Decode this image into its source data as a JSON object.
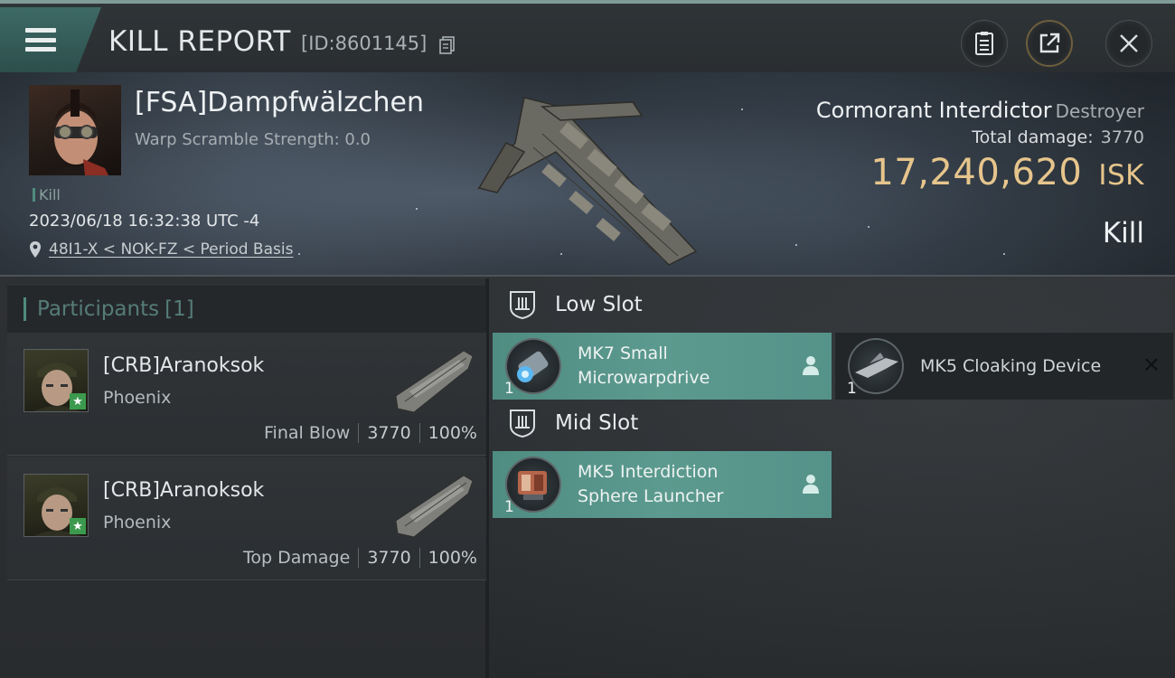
{
  "header": {
    "title": "KILL REPORT",
    "report_id": "[ID:8601145]",
    "icons": [
      "menu-icon",
      "copy-icon",
      "clipboard-icon",
      "share-icon",
      "close-icon"
    ]
  },
  "victim": {
    "name": "[FSA]Dampfwälzchen",
    "warp_scramble": "Warp Scramble Strength: 0.0",
    "tag": "Kill",
    "datetime": "2023/06/18 16:32:38 UTC -4",
    "location": "48I1-X < NOK-FZ < Period Basis"
  },
  "ship": {
    "name": "Cormorant Interdictor",
    "class": "Destroyer",
    "total_damage_label": "Total damage:",
    "total_damage_value": "3770",
    "value": "17,240,620",
    "currency": "ISK",
    "result": "Kill"
  },
  "participants": {
    "title": "Participants",
    "count": "[1]",
    "rows": [
      {
        "name": "[CRB]Aranoksok",
        "ship": "Phoenix",
        "role": "Final Blow",
        "damage": "3770",
        "percent": "100%"
      },
      {
        "name": "[CRB]Aranoksok",
        "ship": "Phoenix",
        "role": "Top Damage",
        "damage": "3770",
        "percent": "100%"
      }
    ]
  },
  "slots": {
    "low": {
      "label": "Low Slot",
      "modules": [
        {
          "line1": "MK7 Small",
          "line2": "Microwarpdrive",
          "qty": "1",
          "state": "fitted"
        },
        {
          "line1": "MK5 Cloaking Device",
          "line2": "",
          "qty": "1",
          "state": "dropped"
        }
      ]
    },
    "mid": {
      "label": "Mid Slot",
      "modules": [
        {
          "line1": "MK5 Interdiction",
          "line2": "Sphere Launcher",
          "qty": "1",
          "state": "fitted"
        }
      ]
    }
  },
  "colors": {
    "accent_teal": "#4f8c82",
    "isk_gold": "#e6c58c",
    "header_tab": "#3e6a66"
  }
}
